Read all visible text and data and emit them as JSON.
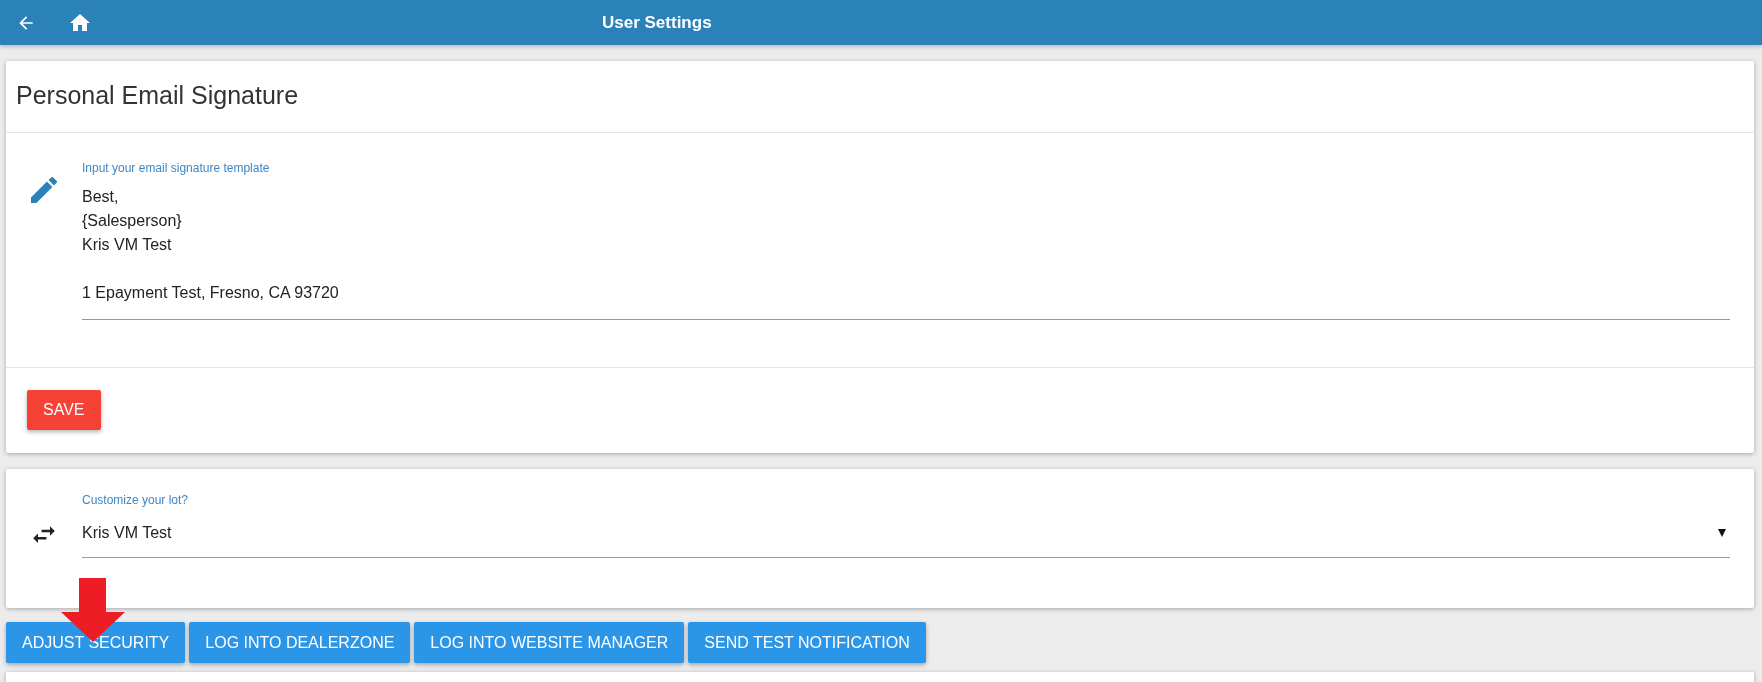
{
  "app_bar": {
    "title": "User Settings"
  },
  "signature_card": {
    "title": "Personal Email Signature",
    "field": {
      "label": "Input your email signature template",
      "value": "Best,\n{Salesperson}\nKris VM Test\n\n1 Epayment Test, Fresno, CA 93720"
    },
    "save_button": "SAVE"
  },
  "lot_card": {
    "field": {
      "label": "Customize your lot?",
      "value": "Kris VM Test"
    }
  },
  "buttons": [
    "ADJUST SECURITY",
    "LOG INTO DEALERZONE",
    "LOG INTO WEBSITE MANAGER",
    "SEND TEST NOTIFICATION"
  ]
}
